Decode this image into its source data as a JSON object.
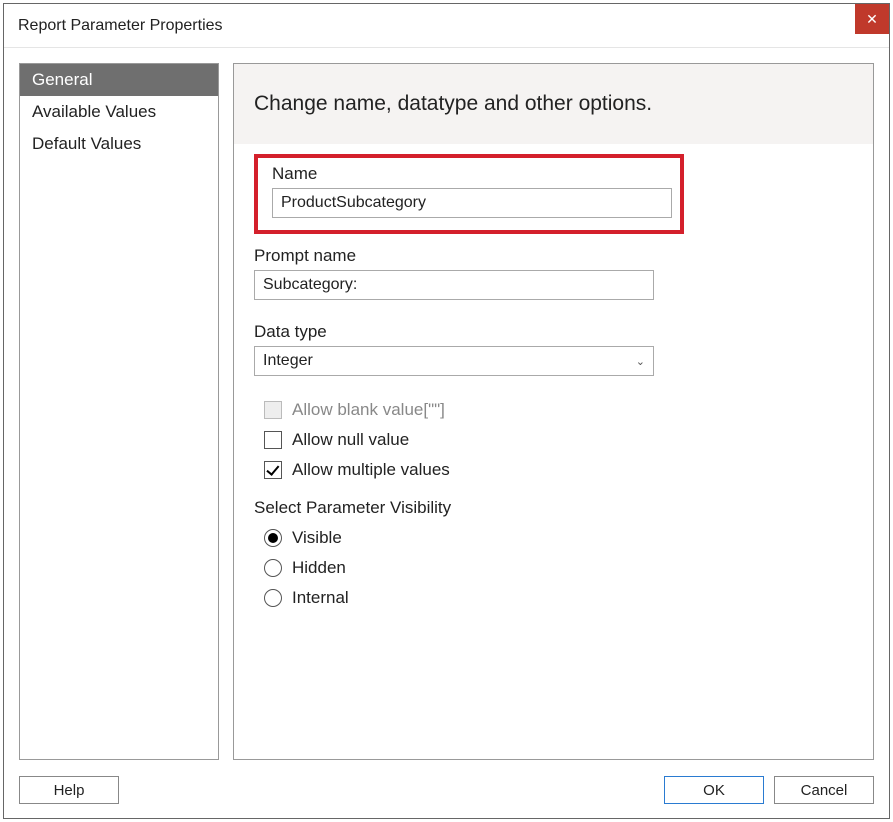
{
  "dialog": {
    "title": "Report Parameter Properties"
  },
  "sidebar": {
    "items": [
      {
        "label": "General",
        "selected": true
      },
      {
        "label": "Available Values",
        "selected": false
      },
      {
        "label": "Default Values",
        "selected": false
      }
    ]
  },
  "content": {
    "header": "Change name, datatype and other options.",
    "name_label": "Name",
    "name_value": "ProductSubcategory",
    "prompt_label": "Prompt name",
    "prompt_value": "Subcategory:",
    "datatype_label": "Data type",
    "datatype_value": "Integer",
    "allow_blank_label": "Allow blank value[\"\"]",
    "allow_blank_checked": false,
    "allow_blank_disabled": true,
    "allow_null_label": "Allow null value",
    "allow_null_checked": false,
    "allow_multiple_label": "Allow multiple values",
    "allow_multiple_checked": true,
    "visibility_label": "Select Parameter Visibility",
    "visibility_options": [
      {
        "label": "Visible",
        "checked": true
      },
      {
        "label": "Hidden",
        "checked": false
      },
      {
        "label": "Internal",
        "checked": false
      }
    ]
  },
  "footer": {
    "help": "Help",
    "ok": "OK",
    "cancel": "Cancel"
  }
}
